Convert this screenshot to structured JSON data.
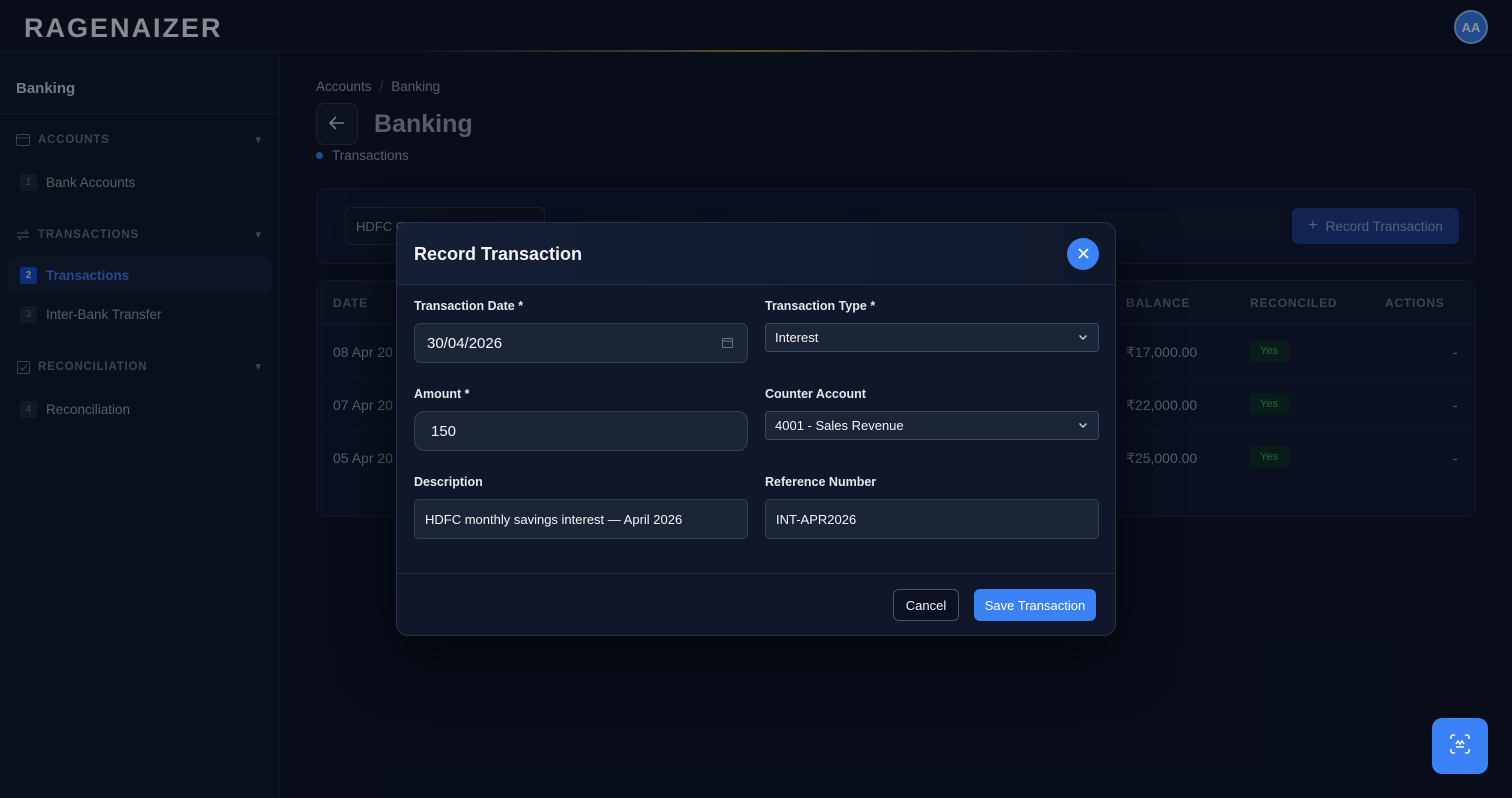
{
  "app": {
    "logo": "RAGENAIZER",
    "user_initials": "AA"
  },
  "sidebar": {
    "title": "Banking",
    "sections": [
      {
        "label": "ACCOUNTS",
        "items": [
          {
            "num": "1",
            "label": "Bank Accounts"
          }
        ]
      },
      {
        "label": "TRANSACTIONS",
        "items": [
          {
            "num": "2",
            "label": "Transactions"
          },
          {
            "num": "3",
            "label": "Inter-Bank Transfer"
          }
        ]
      },
      {
        "label": "RECONCILIATION",
        "items": [
          {
            "num": "4",
            "label": "Reconciliation"
          }
        ]
      }
    ],
    "caret": "▼"
  },
  "breadcrumb": {
    "items": [
      "Accounts",
      "Banking"
    ],
    "separator": "/"
  },
  "page": {
    "title": "Banking",
    "subtab": "Transactions"
  },
  "filters": {
    "account_select": "HDFC C",
    "record_button": "Record Transaction"
  },
  "table": {
    "columns": {
      "date": "DATE",
      "balance": "BALANCE",
      "reconciled": "RECONCILED",
      "actions": "ACTIONS"
    },
    "rows": [
      {
        "date": "08 Apr 20",
        "balance": "₹17,000.00",
        "reconciled": "Yes",
        "actions": "-"
      },
      {
        "date": "07 Apr 20",
        "balance": "₹22,000.00",
        "reconciled": "Yes",
        "actions": "-"
      },
      {
        "date": "05 Apr 20",
        "balance": "₹25,000.00",
        "reconciled": "Yes",
        "actions": "-"
      }
    ]
  },
  "modal": {
    "title": "Record Transaction",
    "fields": {
      "date_label": "Transaction Date *",
      "date_value": "30/04/2026",
      "type_label": "Transaction Type *",
      "type_value": "Interest",
      "amount_label": "Amount *",
      "amount_value": "150",
      "counter_label": "Counter Account",
      "counter_value": "4001 - Sales Revenue",
      "description_label": "Description",
      "description_value": "HDFC monthly savings interest — April 2026",
      "reference_label": "Reference Number",
      "reference_value": "INT-APR2026"
    },
    "cancel_label": "Cancel",
    "save_label": "Save Transaction"
  },
  "colors": {
    "accent": "#3b82f6",
    "background": "#0b1120",
    "success": "#22c55e"
  }
}
